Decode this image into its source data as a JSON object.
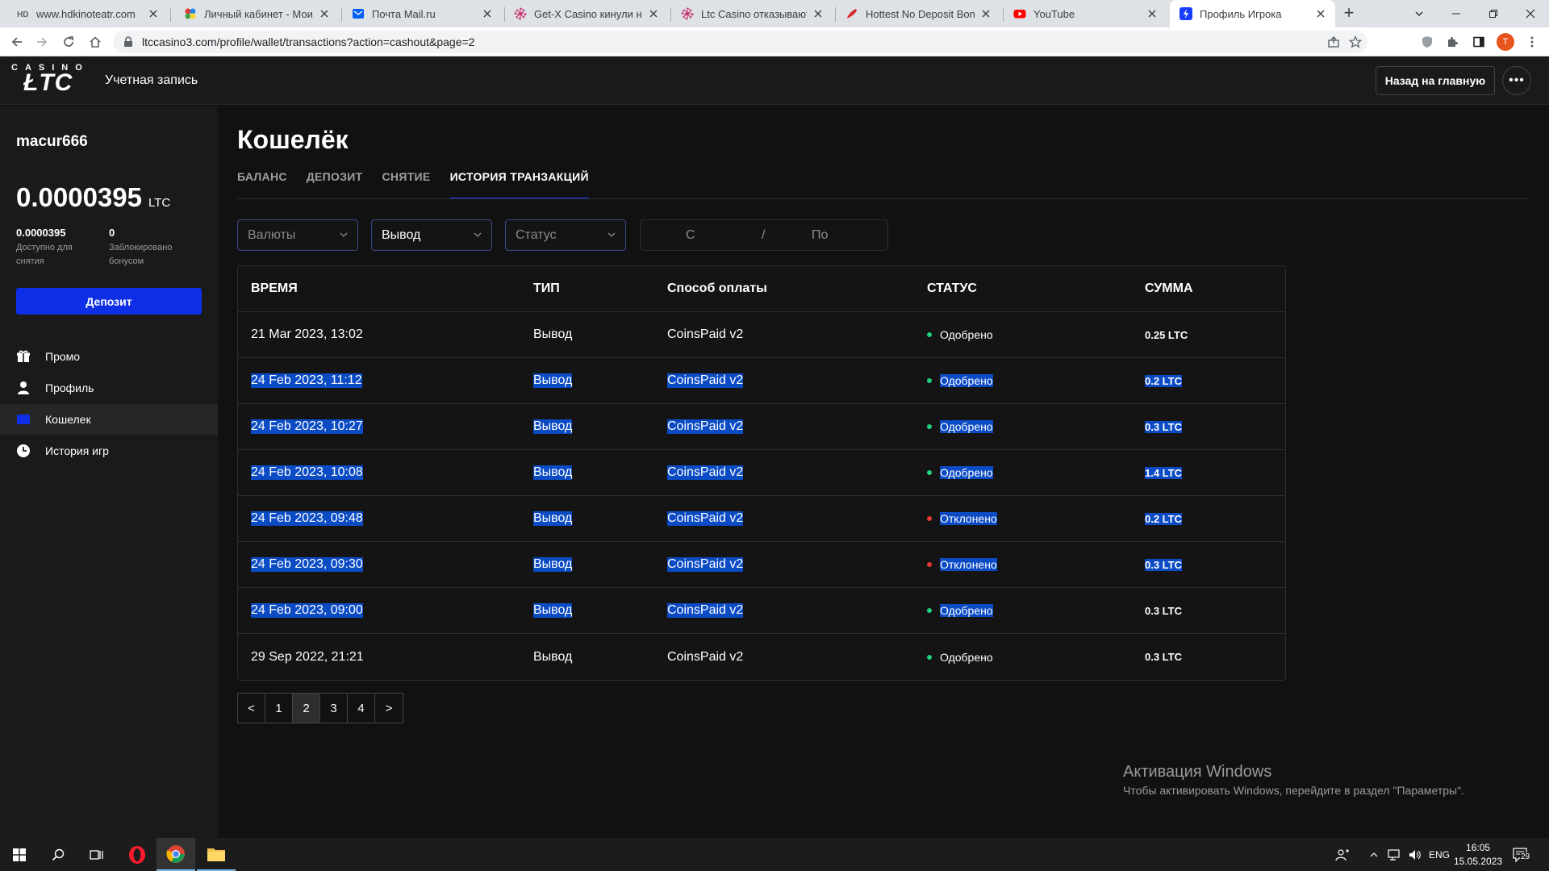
{
  "browser": {
    "tabs": [
      {
        "title": "www.hdkinoteatr.com",
        "icon": "hd-icon",
        "active": false
      },
      {
        "title": "Личный кабинет - Мои о",
        "icon": "colorful-dots-icon",
        "active": false
      },
      {
        "title": "Почта Mail.ru",
        "icon": "mail-icon",
        "active": false
      },
      {
        "title": "Get-X Casino кинули на к",
        "icon": "pinwheel-icon",
        "active": false
      },
      {
        "title": "Ltc Casino отказывают в о",
        "icon": "pinwheel-icon",
        "active": false
      },
      {
        "title": "Hottest No Deposit Bonus",
        "icon": "chili-icon",
        "active": false
      },
      {
        "title": "YouTube",
        "icon": "youtube-icon",
        "active": false
      },
      {
        "title": "Профиль Игрока",
        "icon": "ltc-icon",
        "active": true
      }
    ],
    "new_tab": "+",
    "url": "ltccasino3.com/profile/wallet/transactions?action=cashout&page=2",
    "profile_initial": "T"
  },
  "header": {
    "logo_top": "CASINO",
    "logo_main": "ŁTC",
    "title": "Учетная запись",
    "back_button": "Назад на главную",
    "more_button": "•••"
  },
  "sidebar": {
    "username": "macur666",
    "balance": "0.0000395",
    "currency": "LTC",
    "available_value": "0.0000395",
    "available_label": "Доступно для снятия",
    "bonus_value": "0",
    "bonus_label": "Заблокировано бонусом",
    "deposit_button": "Депозит",
    "items": [
      {
        "label": "Промо",
        "icon": "gift-icon",
        "active": false
      },
      {
        "label": "Профиль",
        "icon": "user-icon",
        "active": false
      },
      {
        "label": "Кошелек",
        "icon": "wallet-icon",
        "active": true
      },
      {
        "label": "История игр",
        "icon": "clock-icon",
        "active": false
      }
    ]
  },
  "main": {
    "title": "Кошелёк",
    "tabs": [
      {
        "label": "БАЛАНС",
        "active": false
      },
      {
        "label": "ДЕПОЗИТ",
        "active": false
      },
      {
        "label": "СНЯТИЕ",
        "active": false
      },
      {
        "label": "ИСТОРИЯ ТРАНЗАКЦИЙ",
        "active": true
      }
    ],
    "filters": {
      "currency_placeholder": "Валюты",
      "type_value": "Вывод",
      "status_placeholder": "Статус",
      "date_from": "С",
      "date_sep": "/",
      "date_to": "По"
    },
    "table": {
      "headers": {
        "time": "ВРЕМЯ",
        "type": "ТИП",
        "method": "Способ оплаты",
        "status": "СТАТУС",
        "amount": "СУММА"
      },
      "rows": [
        {
          "time": "21 Mar 2023, 13:02",
          "type": "Вывод",
          "method": "CoinsPaid v2",
          "status": "Одобрено",
          "approved": true,
          "amount": "0.25 LTC",
          "sel": false,
          "amount_sel": false
        },
        {
          "time": "24 Feb 2023, 11:12",
          "type": "Вывод",
          "method": "CoinsPaid v2",
          "status": "Одобрено",
          "approved": true,
          "amount": "0.2 LTC",
          "sel": true,
          "amount_sel": true
        },
        {
          "time": "24 Feb 2023, 10:27",
          "type": "Вывод",
          "method": "CoinsPaid v2",
          "status": "Одобрено",
          "approved": true,
          "amount": "0.3 LTC",
          "sel": true,
          "amount_sel": true
        },
        {
          "time": "24 Feb 2023, 10:08",
          "type": "Вывод",
          "method": "CoinsPaid v2",
          "status": "Одобрено",
          "approved": true,
          "amount": "1.4 LTC",
          "sel": true,
          "amount_sel": true
        },
        {
          "time": "24 Feb 2023, 09:48",
          "type": "Вывод",
          "method": "CoinsPaid v2",
          "status": "Отклонено",
          "approved": false,
          "amount": "0.2 LTC",
          "sel": true,
          "amount_sel": true
        },
        {
          "time": "24 Feb 2023, 09:30",
          "type": "Вывод",
          "method": "CoinsPaid v2",
          "status": "Отклонено",
          "approved": false,
          "amount": "0.3 LTC",
          "sel": true,
          "amount_sel": true
        },
        {
          "time": "24 Feb 2023, 09:00",
          "type": "Вывод",
          "method": "CoinsPaid v2",
          "status": "Одобрено",
          "approved": true,
          "amount": "0.3 LTC",
          "sel": true,
          "amount_sel": false
        },
        {
          "time": "29 Sep 2022, 21:21",
          "type": "Вывод",
          "method": "CoinsPaid v2",
          "status": "Одобрено",
          "approved": true,
          "amount": "0.3 LTC",
          "sel": false,
          "amount_sel": false
        }
      ]
    },
    "pagination": [
      "<",
      "1",
      "2",
      "3",
      "4",
      ">"
    ],
    "current_page": "2"
  },
  "windows_activation": {
    "title": "Активация Windows",
    "text": "Чтобы активировать Windows, перейдите в раздел \"Параметры\"."
  },
  "taskbar": {
    "lang": "ENG",
    "time": "16:05",
    "date": "15.05.2023",
    "notifications": "29"
  },
  "colors": {
    "accent": "#0f2fe6",
    "approved": "#1fd17b",
    "rejected": "#e53935",
    "selection": "#0b4bc4"
  }
}
